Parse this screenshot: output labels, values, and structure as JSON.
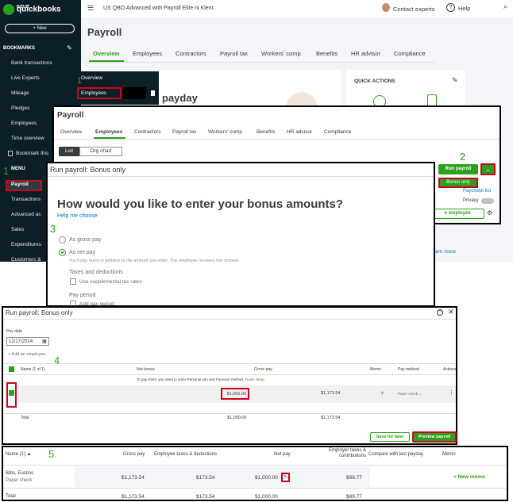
{
  "sidebar": {
    "logo_small": "INTUIT",
    "logo": "quickbooks",
    "new_label": "+ New",
    "bookmarks_header": "BOOKMARKS",
    "bookmark_items": [
      "Bank transactions",
      "Live Experts",
      "Mileage",
      "Pledges",
      "Employees",
      "Time overview",
      "Bookmark this"
    ],
    "menu_header": "MENU",
    "menu_items": [
      "Payroll",
      "Transactions",
      "Advanced ac",
      "Sales",
      "Expenditures",
      "Customers &"
    ]
  },
  "topbar": {
    "company": "US QBO Advanced with Payroll Elite ni Klent",
    "contact": "Contact experts",
    "help": "Help"
  },
  "payroll_page": {
    "title": "Payroll",
    "tabs": [
      "Overview",
      "Employees",
      "Contractors",
      "Payroll tax",
      "Workers' comp",
      "Benefits",
      "HR advisor",
      "Compliance"
    ],
    "card_heading": "payday",
    "quick_actions": "QUICK ACTIONS",
    "learn_more": "arn more"
  },
  "dropdown": {
    "items": [
      "Overview",
      "Employees"
    ]
  },
  "step_numbers": {
    "s1a": "1",
    "s1b": "1",
    "s2": "2",
    "s3": "3",
    "s4": "4",
    "s5": "5"
  },
  "screen2": {
    "title": "Payroll",
    "tabs": [
      "Overview",
      "Employees",
      "Contractors",
      "Payroll tax",
      "Workers' comp",
      "Benefits",
      "HR advisor",
      "Compliance"
    ],
    "list_label": "List",
    "org_chart_label": "Org chart",
    "run_payroll": "Run payroll",
    "bonus_only": "Bonus only",
    "paycheck_list": "Paycheck list",
    "privacy": "Privacy",
    "add_employee": "n employee"
  },
  "screen3": {
    "header": "Run payroll: Bonus only",
    "question": "How would you like to enter your bonus amounts?",
    "help": "Help me choose",
    "opt_gross": "As gross pay",
    "opt_net": "As net pay",
    "net_desc": "You'll pay taxes in addition to the amount you enter. The employee receives this amount.",
    "taxes_label": "Taxes and deductions",
    "supp_label": "Use supplemental tax rates",
    "pay_period_label": "Pay period",
    "add_pay_period": "Add pay period"
  },
  "screen4": {
    "header": "Run payroll: Bonus only",
    "pay_date_label": "Pay date",
    "pay_date": "12/17/2024",
    "add_employee": "+ Add an employee",
    "cols": [
      "Name (1 of 1)",
      "Net bonus",
      "Gross pay",
      "Memo",
      "Pay method",
      "Actions"
    ],
    "notice": "To pay Klent, you need to enter Personal info and Payment method.",
    "notice_link": "Finish setup",
    "net_bonus_value": "$1,000.00",
    "gross_value": "$1,173.54",
    "pay_method": "Paper check",
    "total_label": "Total",
    "total_net": "$1,000.00",
    "total_gross": "$1,173.54",
    "save_later": "Save for later",
    "preview": "Preview payroll"
  },
  "screen5": {
    "cols": [
      "Name (1)",
      "Gross pay",
      "Employee taxes & deductions",
      "Net pay",
      "Employer taxes & contributions",
      "Compare with last payday",
      "Memo"
    ],
    "row": {
      "name": "Bibo, Eustins",
      "method": "Paper check",
      "gross": "$1,173.54",
      "taxes": "$173.54",
      "net": "$1,000.00",
      "employer": "$89.77",
      "memo": "+ New memo"
    },
    "total": {
      "label": "Total",
      "gross": "$1,173.54",
      "taxes": "$173.54",
      "net": "$1,000.00",
      "employer": "$89.77"
    }
  }
}
